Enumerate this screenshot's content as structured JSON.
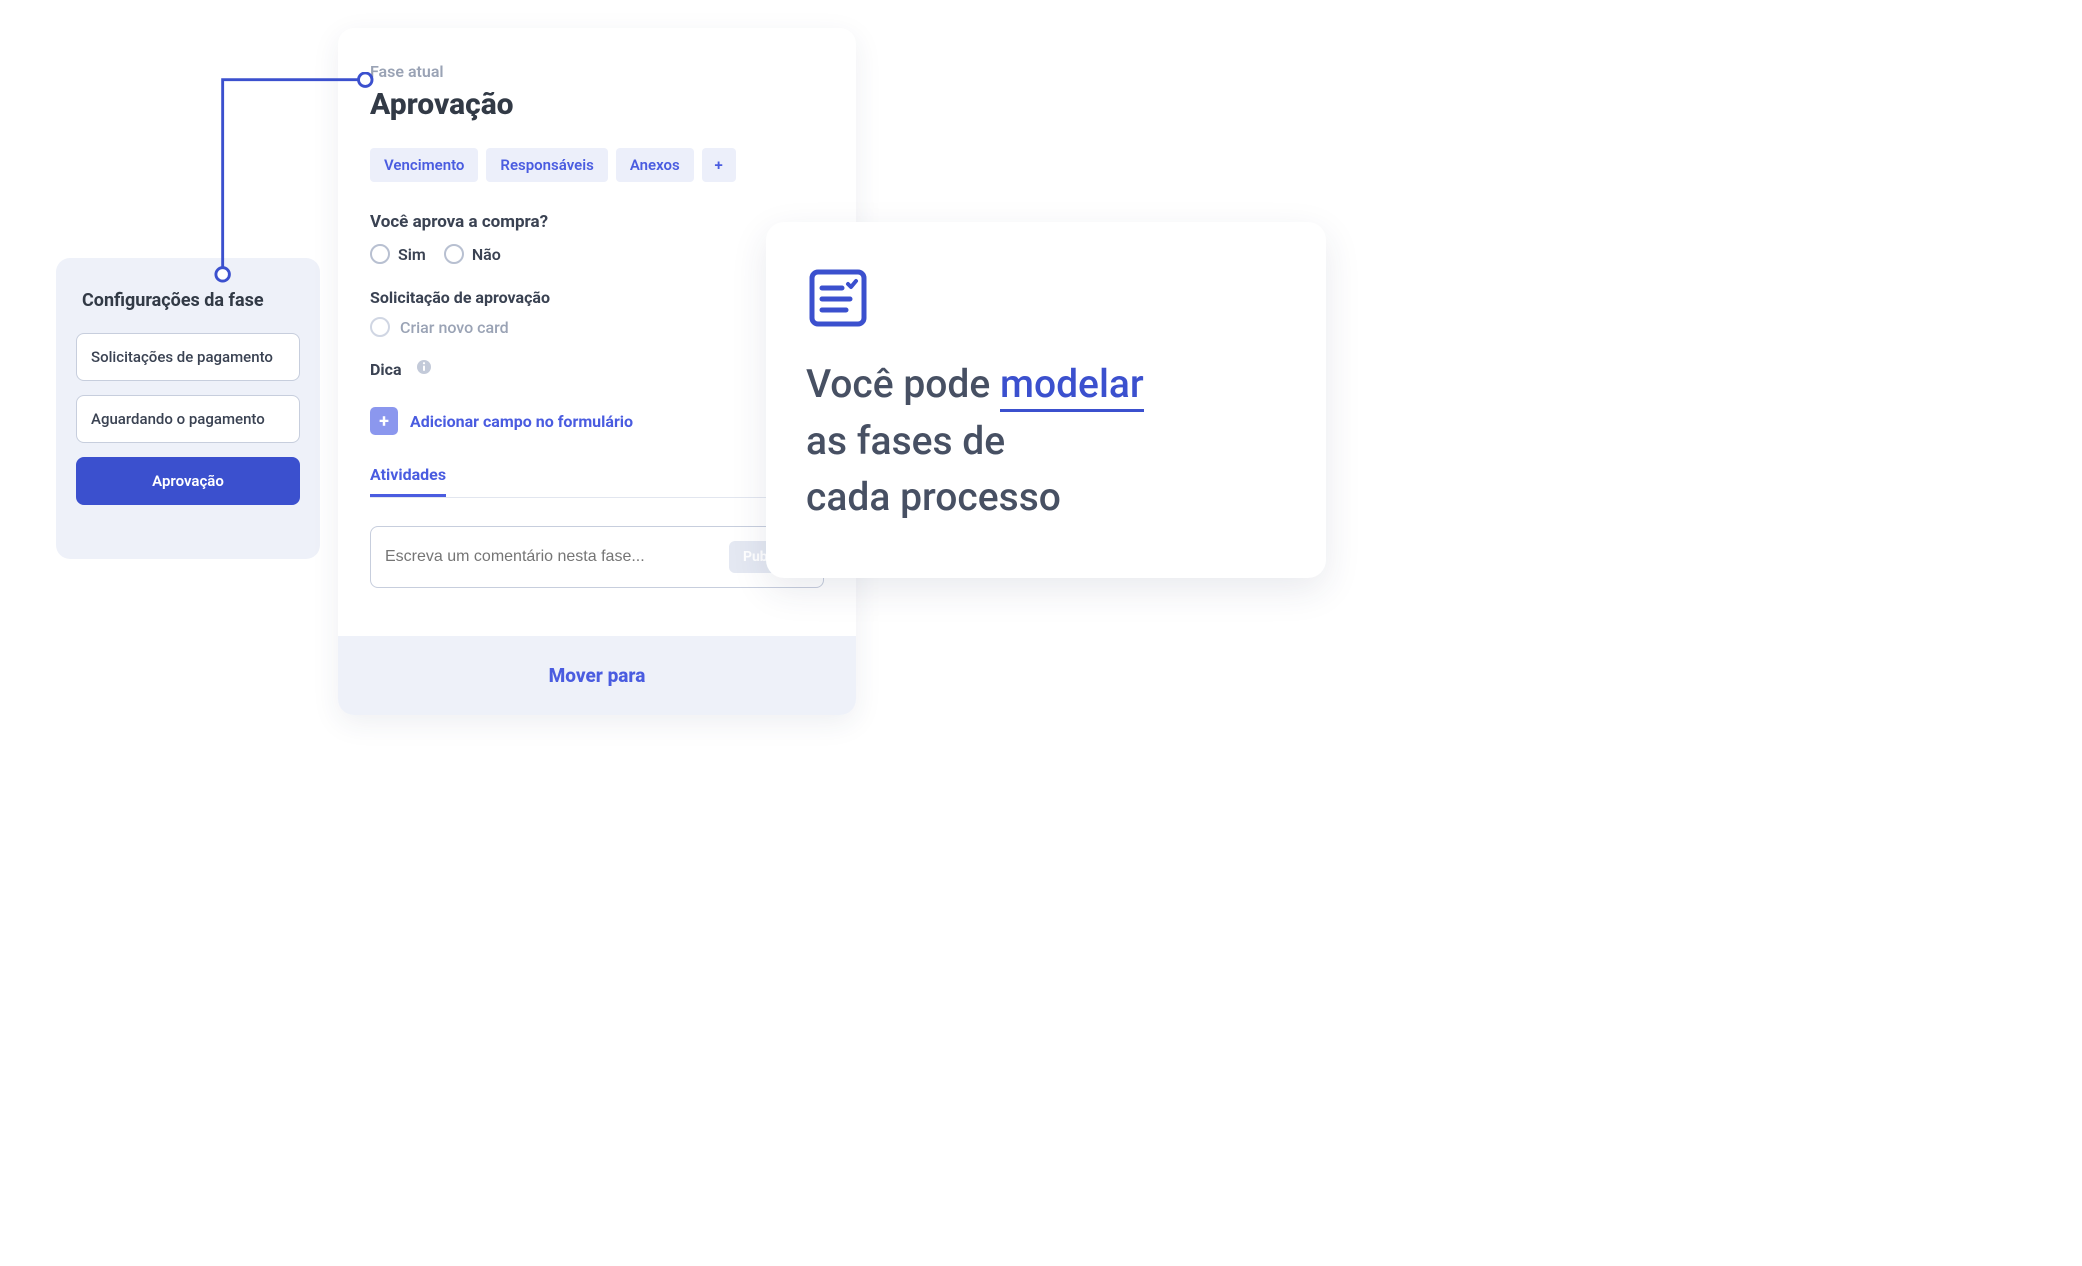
{
  "sidebar": {
    "title": "Configurações da fase",
    "items": [
      {
        "label": "Solicitações de pagamento",
        "active": false
      },
      {
        "label": "Aguardando o pagamento",
        "active": false
      },
      {
        "label": "Aprovação",
        "active": true
      }
    ]
  },
  "phase": {
    "current_label": "Fase atual",
    "title": "Aprovação",
    "chips": [
      "Vencimento",
      "Responsáveis",
      "Anexos"
    ],
    "chip_add": "+",
    "question": "Você aprova a compra?",
    "option_yes": "Sim",
    "option_no": "Não",
    "approval_request_label": "Solicitação de aprovação",
    "create_card_label": "Criar novo card",
    "hint_label": "Dica",
    "add_field_label": "Adicionar campo no formulário",
    "tab_activities": "Atividades",
    "comment_placeholder": "Escreva um comentário nesta fase...",
    "publish_label": "Publicar",
    "move_to_label": "Mover para"
  },
  "info": {
    "prefix": "Você pode ",
    "accent": "modelar",
    "suffix1": " as fases de",
    "suffix2": "cada processo"
  }
}
